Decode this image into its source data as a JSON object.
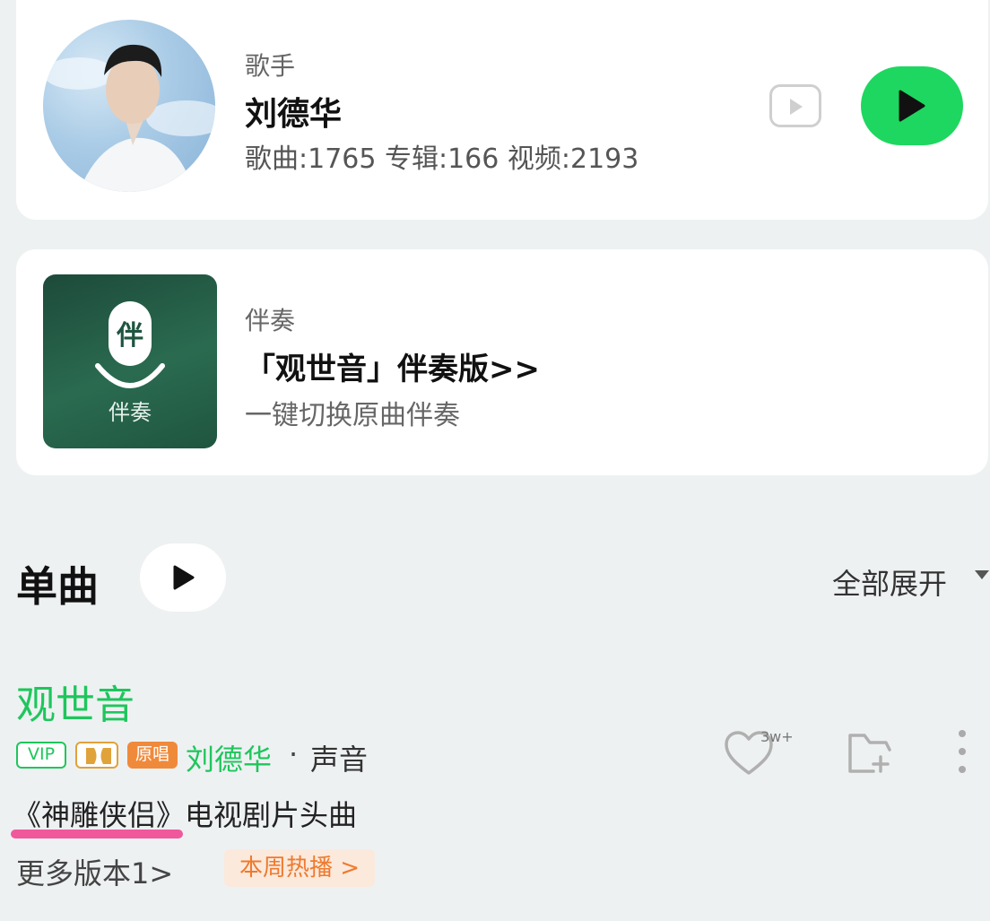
{
  "artist": {
    "tag": "歌手",
    "name": "刘德华",
    "stats": "歌曲:1765 专辑:166 视频:2193"
  },
  "accompaniment": {
    "icon_glyph": "伴",
    "icon_label": "伴奏",
    "tag": "伴奏",
    "title": "「观世音」伴奏版>>",
    "subtitle": "一键切换原曲伴奏"
  },
  "section": {
    "title": "单曲",
    "expand_label": "全部展开"
  },
  "song": {
    "title": "观世音",
    "badge_vip": "VIP",
    "badge_original": "原唱",
    "artist": "刘德华",
    "separator": "·",
    "album": "声音",
    "description": "《神雕侠侣》电视剧片头曲",
    "favorite_count": "3w+",
    "more_versions": "更多版本1>",
    "hot_tag": "本周热播 >"
  },
  "colors": {
    "accent_green": "#1ed760",
    "song_green": "#1ec65c",
    "hot_orange": "#ef7a2e",
    "highlight_pink": "#f0589c"
  }
}
